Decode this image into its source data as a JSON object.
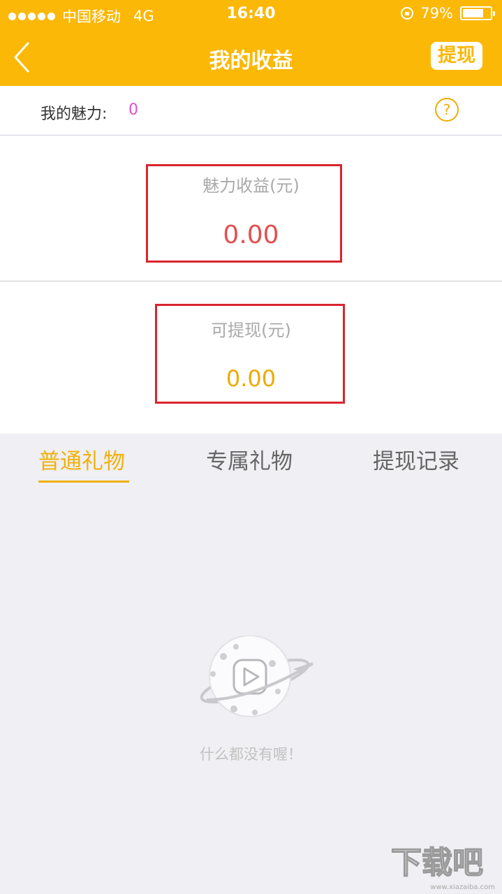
{
  "status": {
    "carrier": "中国移动",
    "network": "4G",
    "time": "16:40",
    "battery": "79%"
  },
  "nav": {
    "title": "我的收益",
    "withdraw_label": "提现"
  },
  "charm": {
    "label": "我的魅力:",
    "value": "0",
    "help": "?"
  },
  "earnings": {
    "charm_caption": "魅力收益(元)",
    "charm_amount": "0.00",
    "withdrawable_caption": "可提现(元)",
    "withdrawable_amount": "0.00"
  },
  "tabs": [
    {
      "label": "普通礼物",
      "active": true
    },
    {
      "label": "专属礼物",
      "active": false
    },
    {
      "label": "提现记录",
      "active": false
    }
  ],
  "empty": {
    "message": "什么都没有喔！"
  },
  "watermark": {
    "text": "下载吧",
    "url": "www.xiazaiba.com"
  },
  "colors": {
    "brand": "#fcb807",
    "highlight_box": "#d9242e",
    "charm_amount": "#e15050",
    "withdraw_amount": "#eeaa00",
    "charm_value": "#e34fcd"
  }
}
